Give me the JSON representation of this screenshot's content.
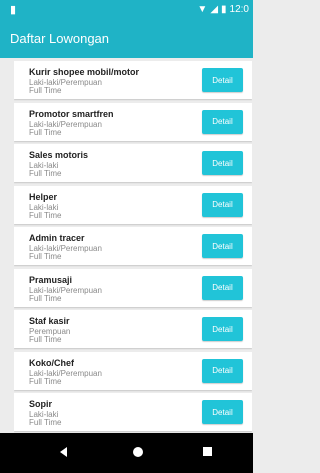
{
  "colors": {
    "primary": "#1fb3c6",
    "detail_button": "#21c4d8",
    "nav_bar": "#000000",
    "background": "#ececec"
  },
  "status_bar": {
    "notification_icon": "notification-icon",
    "time": "12:0"
  },
  "app_bar": {
    "title": "Daftar Lowongan"
  },
  "jobs": [
    {
      "title": "Kurir shopee mobil/motor",
      "gender": "Laki-laki/Perempuan",
      "type": "Full Time",
      "button": "Detail"
    },
    {
      "title": "Promotor smartfren",
      "gender": "Laki-laki/Perempuan",
      "type": "Full Time",
      "button": "Detail"
    },
    {
      "title": "Sales motoris",
      "gender": "Laki-laki",
      "type": "Full Time",
      "button": "Detail"
    },
    {
      "title": "Helper",
      "gender": "Laki-laki",
      "type": "Full Time",
      "button": "Detail"
    },
    {
      "title": "Admin tracer",
      "gender": "Laki-laki/Perempuan",
      "type": "Full Time",
      "button": "Detail"
    },
    {
      "title": "Pramusaji",
      "gender": "Laki-laki/Perempuan",
      "type": "Full Time",
      "button": "Detail"
    },
    {
      "title": "Staf kasir",
      "gender": "Perempuan",
      "type": "Full Time",
      "button": "Detail"
    },
    {
      "title": "Koko/Chef",
      "gender": "Laki-laki/Perempuan",
      "type": "Full Time",
      "button": "Detail"
    },
    {
      "title": "Sopir",
      "gender": "Laki-laki",
      "type": "Full Time",
      "button": "Detail"
    }
  ]
}
